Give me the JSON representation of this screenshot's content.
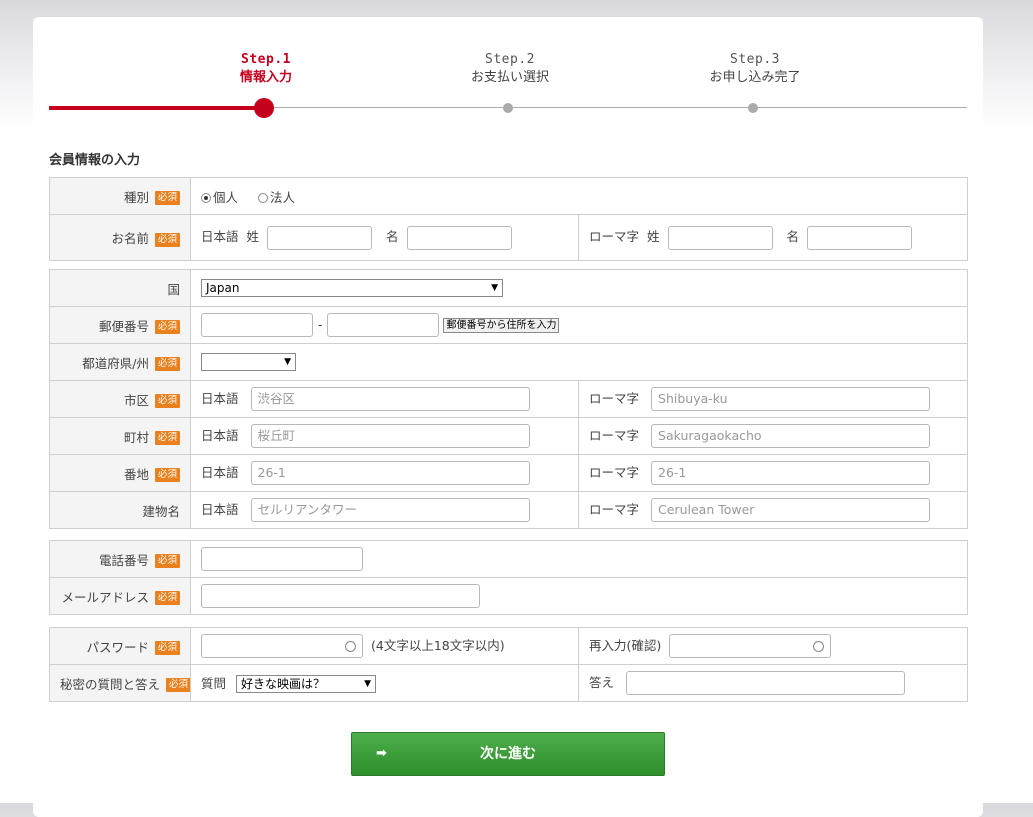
{
  "steps": [
    {
      "num": "Step.1",
      "label": "情報入力",
      "active": true
    },
    {
      "num": "Step.2",
      "label": "お支払い選択",
      "active": false
    },
    {
      "num": "Step.3",
      "label": "お申し込み完了",
      "active": false
    }
  ],
  "section_title": "会員情報の入力",
  "required_badge": "必須",
  "type_row": {
    "label": "種別",
    "opt_individual": "個人",
    "opt_corp": "法人"
  },
  "name_row": {
    "label": "お名前",
    "jp": "日本語",
    "sei": "姓",
    "mei": "名",
    "roman": "ローマ字",
    "sei2": "姓",
    "mei2": "名"
  },
  "country_row": {
    "label": "国",
    "value": "Japan"
  },
  "zip_row": {
    "label": "郵便番号",
    "dash": "-",
    "button": "郵便番号から住所を入力"
  },
  "pref_row": {
    "label": "都道府県/州",
    "value": ""
  },
  "city_row": {
    "label": "市区",
    "jp": "日本語",
    "jp_placeholder": "渋谷区",
    "roman": "ローマ字",
    "roman_placeholder": "Shibuya-ku"
  },
  "town_row": {
    "label": "町村",
    "jp": "日本語",
    "jp_placeholder": "桜丘町",
    "roman": "ローマ字",
    "roman_placeholder": "Sakuragaokacho"
  },
  "block_row": {
    "label": "番地",
    "jp": "日本語",
    "jp_placeholder": "26-1",
    "roman": "ローマ字",
    "roman_placeholder": "26-1"
  },
  "building_row": {
    "label": "建物名",
    "jp": "日本語",
    "jp_placeholder": "セルリアンタワー",
    "roman": "ローマ字",
    "roman_placeholder": "Cerulean Tower"
  },
  "phone_row": {
    "label": "電話番号"
  },
  "email_row": {
    "label": "メールアドレス"
  },
  "password_row": {
    "label": "パスワード",
    "hint": "(4文字以上18文字以内)",
    "confirm": "再入力(確認)"
  },
  "secret_row": {
    "label": "秘密の質問と答え",
    "question": "質問",
    "question_value": "好きな映画は？",
    "answer": "答え"
  },
  "next_button": {
    "label": "次に進む",
    "arrow": "➡"
  },
  "colors": {
    "accent": "#c4001d",
    "required": "#e8811e",
    "button": "#3a9a38"
  }
}
